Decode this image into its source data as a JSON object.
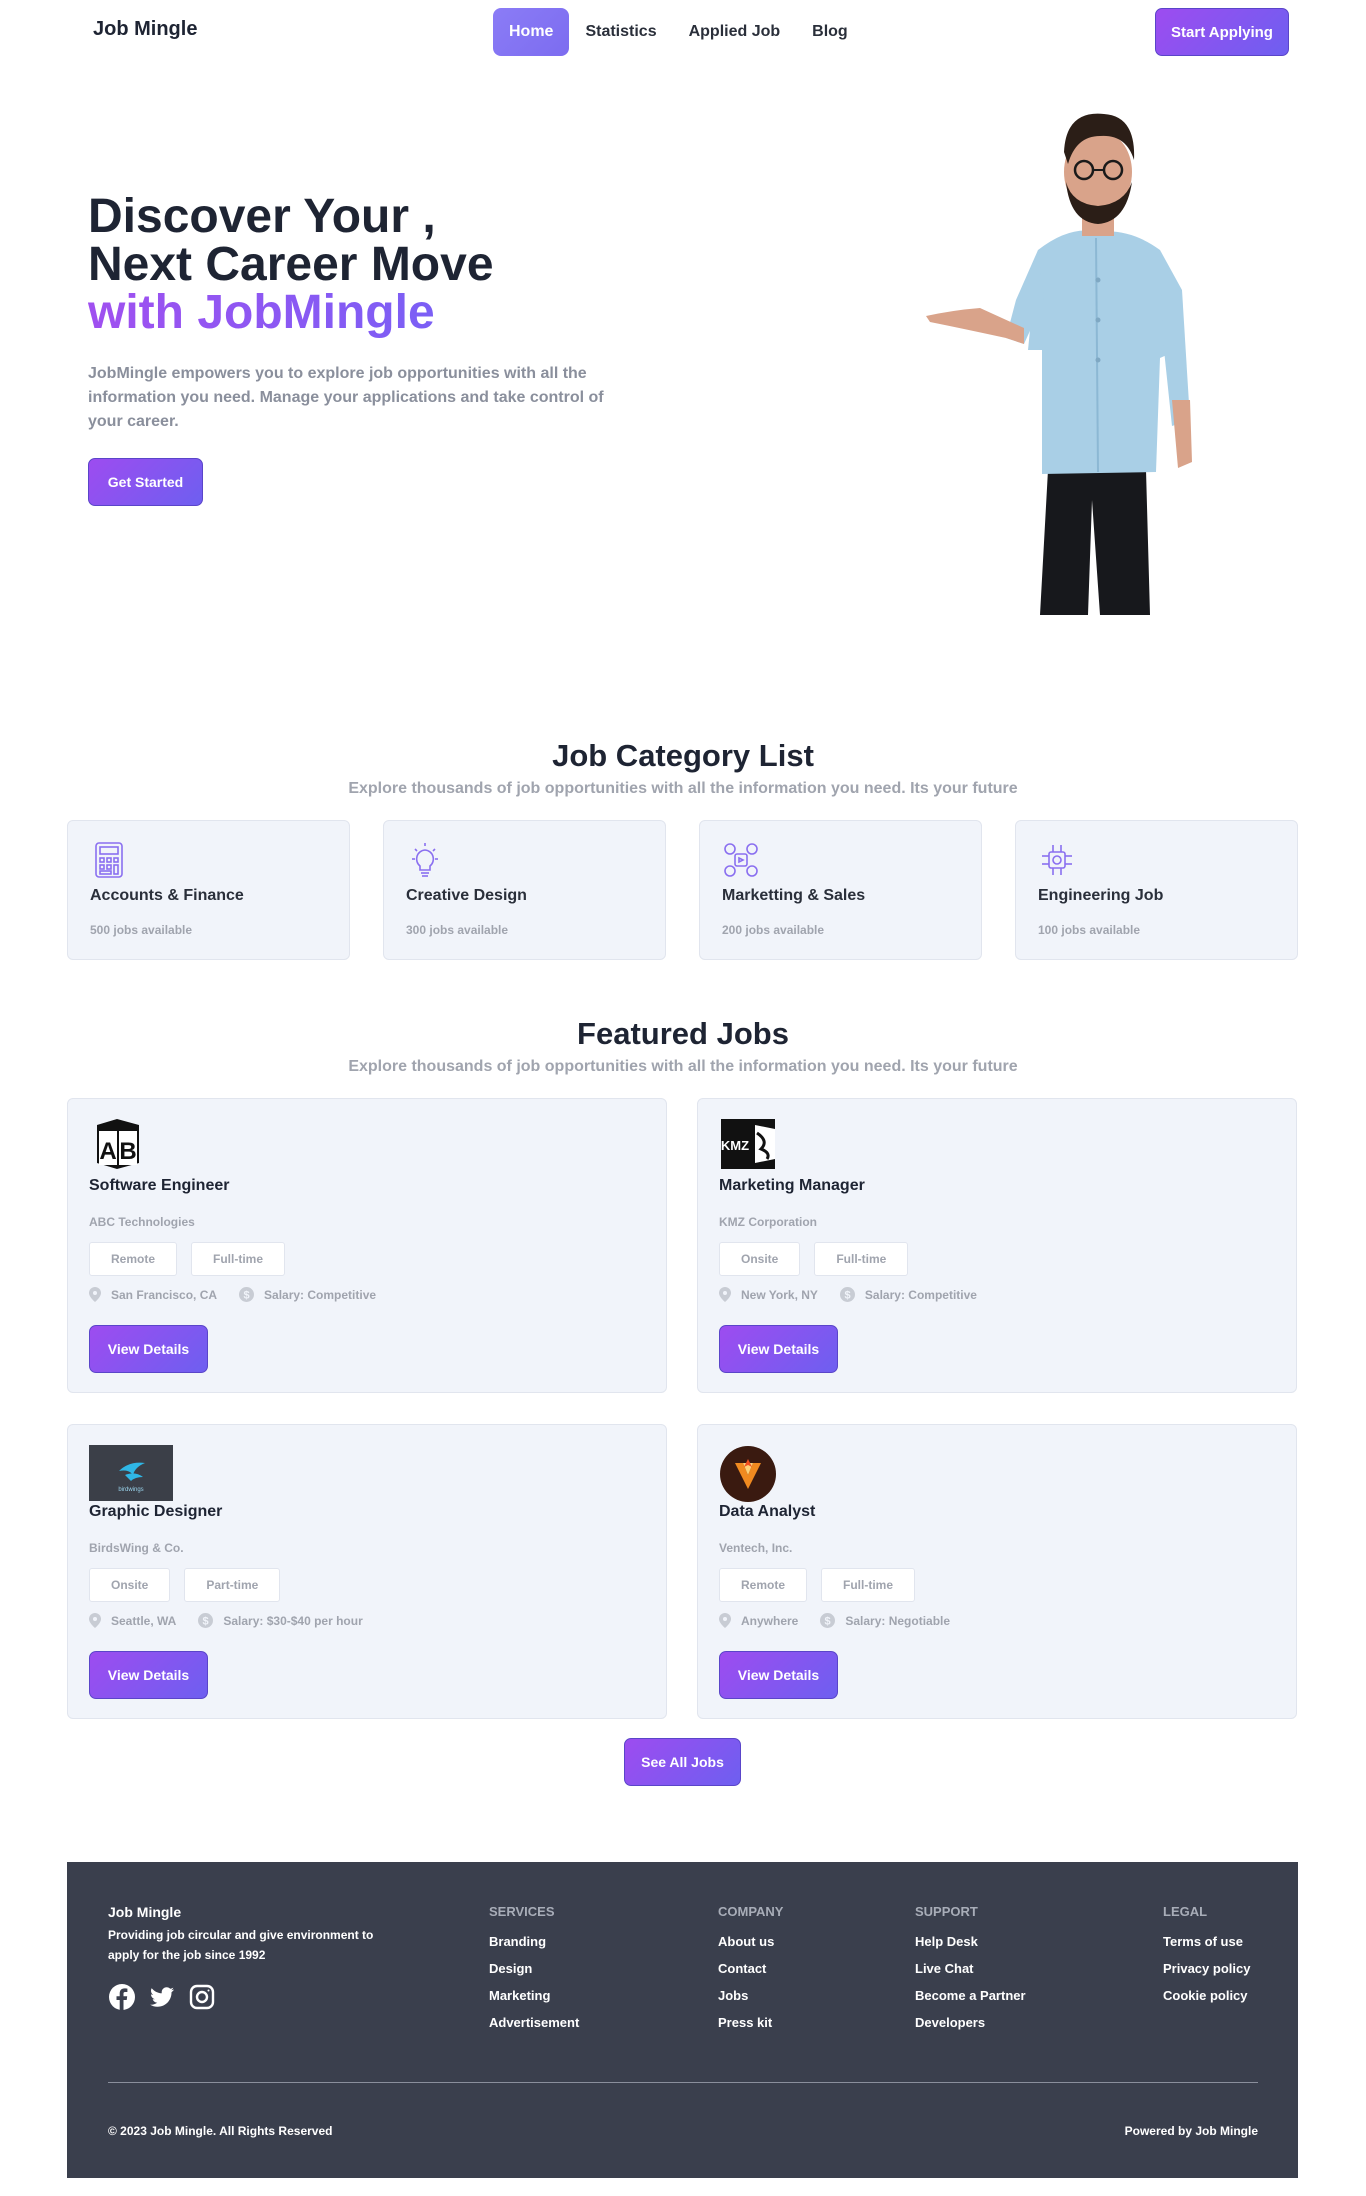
{
  "nav": {
    "brand": "Job Mingle",
    "items": [
      {
        "label": "Home",
        "active": true
      },
      {
        "label": "Statistics",
        "active": false
      },
      {
        "label": "Applied Job",
        "active": false
      },
      {
        "label": "Blog",
        "active": false
      }
    ],
    "cta": "Start Applying"
  },
  "hero": {
    "line1": "Discover Your ,",
    "line2": "Next Career Move",
    "line3": "with JobMingle",
    "description": "JobMingle empowers you to explore job opportunities with all the information you need. Manage your applications and take control of your career.",
    "button": "Get Started"
  },
  "categories": {
    "title": "Job Category List",
    "subtitle": "Explore thousands of job opportunities with all the information you need. Its your future",
    "items": [
      {
        "name": "Accounts & Finance",
        "count": "500 jobs available",
        "icon": "calculator-icon"
      },
      {
        "name": "Creative Design",
        "count": "300 jobs available",
        "icon": "lightbulb-icon"
      },
      {
        "name": "Marketting & Sales",
        "count": "200 jobs available",
        "icon": "social-media-icon"
      },
      {
        "name": "Engineering Job",
        "count": "100 jobs available",
        "icon": "chip-icon"
      }
    ]
  },
  "featured": {
    "title": "Featured Jobs",
    "subtitle": "Explore thousands of job opportunities with all the information you need. Its your future",
    "jobs": [
      {
        "title": "Software Engineer",
        "company": "ABC Technologies",
        "tag1": "Remote",
        "tag2": "Full-time",
        "location": "San Francisco, CA",
        "salary": "Salary: Competitive",
        "button": "View Details",
        "logo_text": "AB"
      },
      {
        "title": "Marketing Manager",
        "company": "KMZ Corporation",
        "tag1": "Onsite",
        "tag2": "Full-time",
        "location": "New York, NY",
        "salary": "Salary: Competitive",
        "button": "View Details",
        "logo_text": "KMZ"
      },
      {
        "title": "Graphic Designer",
        "company": "BirdsWing & Co.",
        "tag1": "Onsite",
        "tag2": "Part-time",
        "location": "Seattle, WA",
        "salary": "Salary: $30-$40 per hour",
        "button": "View Details",
        "logo_text": "birdwings"
      },
      {
        "title": "Data Analyst",
        "company": "Ventech, Inc.",
        "tag1": "Remote",
        "tag2": "Full-time",
        "location": "Anywhere",
        "salary": "Salary: Negotiable",
        "button": "View Details",
        "logo_text": "V"
      }
    ],
    "see_all": "See All Jobs"
  },
  "footer": {
    "brand": "Job Mingle",
    "description": "Providing job circular and give environment to apply for the job since 1992",
    "social": [
      "facebook-icon",
      "twitter-icon",
      "instagram-icon"
    ],
    "services": {
      "heading": "SERVICES",
      "links": [
        "Branding",
        "Design",
        "Marketing",
        "Advertisement"
      ]
    },
    "company": {
      "heading": "COMPANY",
      "links": [
        "About us",
        "Contact",
        "Jobs",
        "Press kit"
      ]
    },
    "support": {
      "heading": "SUPPORT",
      "links": [
        "Help Desk",
        "Live Chat",
        "Become a Partner",
        "Developers"
      ]
    },
    "legal": {
      "heading": "LEGAL",
      "links": [
        "Terms of use",
        "Privacy policy",
        "Cookie policy"
      ]
    },
    "copyright": "© 2023 Job Mingle. All Rights Reserved",
    "powered": "Powered by Job Mingle"
  },
  "colors": {
    "accent": "#8a4ff0",
    "accent2": "#6e5ff0",
    "card_bg": "#f1f4fa",
    "footer_bg": "#3a3f4d"
  }
}
